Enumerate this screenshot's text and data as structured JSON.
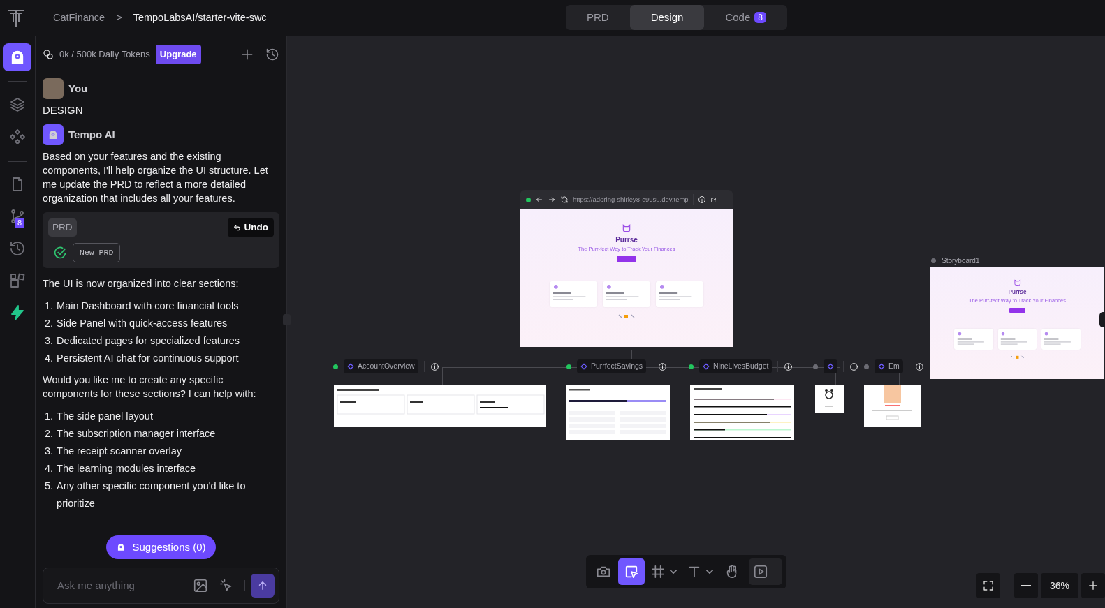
{
  "topbar": {
    "breadcrumb": [
      "CatFinance",
      "TempoLabsAI/starter-vite-swc"
    ],
    "separator": ">",
    "tabs": [
      {
        "label": "PRD",
        "selected": false
      },
      {
        "label": "Design",
        "selected": true
      },
      {
        "label": "Code",
        "selected": false,
        "badge": "8"
      }
    ]
  },
  "rail": {
    "groups": [
      [
        {
          "kind": "tempo",
          "selected": true
        }
      ],
      [
        {
          "kind": "layers",
          "selected": false
        },
        {
          "kind": "components",
          "selected": false
        }
      ],
      [
        {
          "kind": "file",
          "selected": false
        },
        {
          "kind": "git",
          "selected": false,
          "badge": "8"
        },
        {
          "kind": "history",
          "selected": false
        },
        {
          "kind": "blocks",
          "selected": false
        },
        {
          "kind": "bolt",
          "selected": false
        }
      ]
    ]
  },
  "chat": {
    "tokens": "0k / 500k Daily Tokens",
    "upgrade": "Upgrade",
    "messages": [
      {
        "kind": "user",
        "author": "You",
        "blocks": [
          {
            "kind": "heading",
            "text": "DESIGN"
          }
        ]
      },
      {
        "kind": "ai",
        "author": "Tempo AI",
        "blocks": [
          {
            "kind": "paragraph",
            "text": "Based on your features and the existing components, I'll help organize the UI structure. Let me update the PRD to reflect a more detailed organization that includes all your features."
          },
          {
            "kind": "prd_card",
            "tag": "PRD",
            "undo": "Undo",
            "file": "New PRD",
            "done": true
          },
          {
            "kind": "paragraph",
            "text": "The UI is now organized into clear sections:"
          },
          {
            "kind": "list",
            "items": [
              {
                "marker": "1.",
                "text": "Main Dashboard with core financial tools"
              },
              {
                "marker": "2.",
                "text": "Side Panel with quick-access features"
              },
              {
                "marker": "3.",
                "text": "Dedicated pages for specialized features"
              },
              {
                "marker": "4.",
                "text": "Persistent AI chat for continuous support"
              }
            ]
          },
          {
            "kind": "paragraph",
            "text": "Would you like me to create any specific components for these sections? I can help with:"
          },
          {
            "kind": "list",
            "items": [
              {
                "marker": "1.",
                "text": "The side panel layout"
              },
              {
                "marker": "2.",
                "text": "The subscription manager interface"
              },
              {
                "marker": "3.",
                "text": "The receipt scanner overlay"
              },
              {
                "marker": "4.",
                "text": "The learning modules interface"
              },
              {
                "marker": "5.",
                "text": "Any other specific component you'd like to prioritize"
              }
            ]
          }
        ]
      }
    ],
    "suggestions": "Suggestions (0)",
    "input": {
      "placeholder": "Ask me anything"
    }
  },
  "canvas": {
    "browser": {
      "url": "https://adoring-shirley8-c99su.dev.temp",
      "preview": {
        "title": "Purrse",
        "tagline": "The Purr-fect Way to Track Your Finances"
      }
    },
    "components": [
      {
        "name": "AccountOverview",
        "color": "#22c55e",
        "kind": "overview"
      },
      {
        "name": "PurrfectSavings",
        "color": "#22c55e",
        "kind": "savings"
      },
      {
        "name": "NineLivesBudget",
        "color": "#22c55e",
        "kind": "budget"
      },
      {
        "color": "#6b6b73",
        "kind": "loader"
      },
      {
        "name": "Em",
        "color": "#6b6b73",
        "kind": "error"
      }
    ],
    "storyboard": {
      "name": "Storyboard1",
      "color": "#6b6b73",
      "preview": {
        "title": "Purrse",
        "tagline": "The Purr-fect Way to Track Your Finances"
      }
    }
  },
  "toolbar": {
    "tools": [
      {
        "kind": "camera",
        "selected": false,
        "menu": false
      },
      {
        "kind": "select",
        "selected": true,
        "menu": false
      },
      {
        "kind": "frame",
        "selected": false,
        "menu": true
      },
      {
        "kind": "text",
        "selected": false,
        "menu": true
      },
      {
        "kind": "hand",
        "selected": false,
        "menu": false
      },
      {
        "kind": "play",
        "selected": false,
        "menu": false
      }
    ]
  },
  "zoom": {
    "value": "36%"
  }
}
